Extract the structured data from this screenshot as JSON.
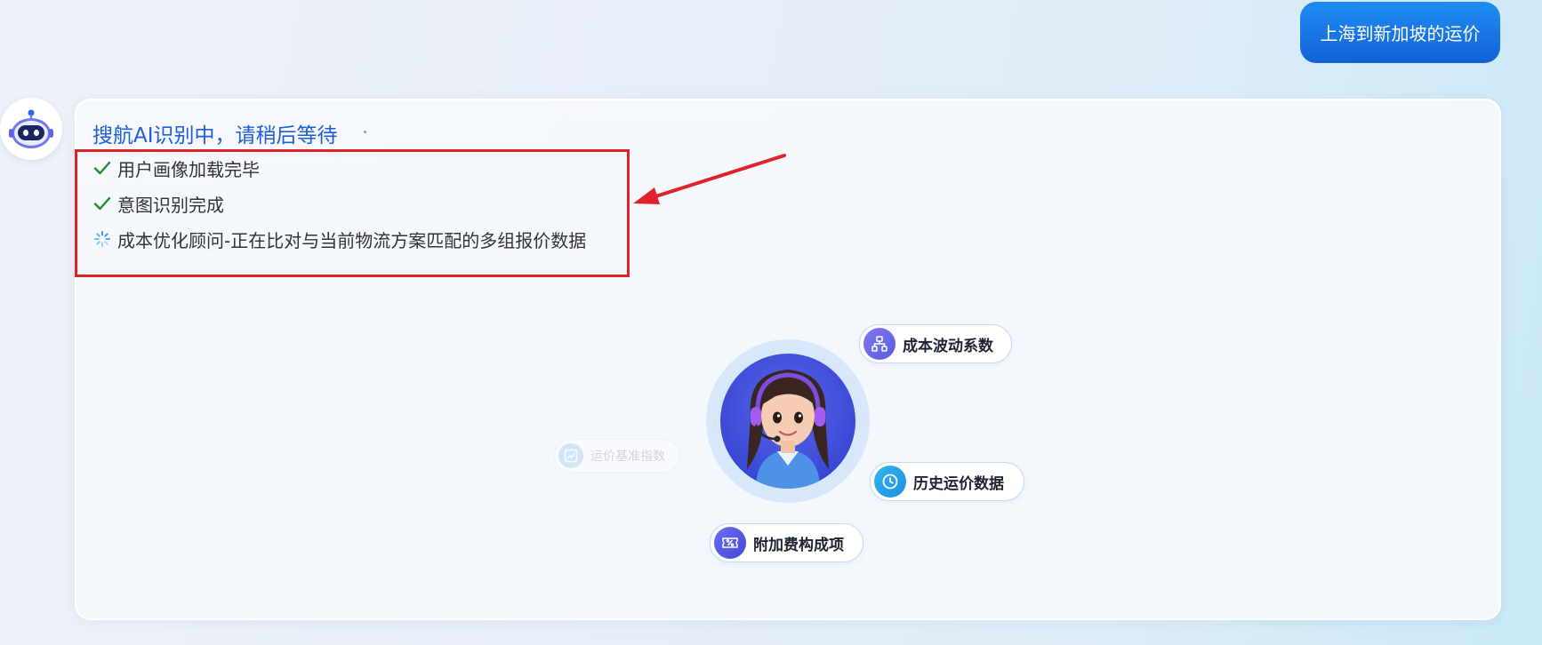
{
  "user_message": "上海到新加坡的运价",
  "assistant": {
    "status_title": "搜航AI识别中，请稍后等待",
    "steps": [
      {
        "label": "用户画像加载完毕",
        "state": "done",
        "icon": "check-icon"
      },
      {
        "label": "意图识别完成",
        "state": "done",
        "icon": "check-icon"
      },
      {
        "label": "成本优化顾问-正在比对与当前物流方案匹配的多组报价数据",
        "state": "loading",
        "icon": "spinner-icon"
      }
    ]
  },
  "agent_diagram": {
    "center": "customer-service-agent-avatar",
    "nodes": [
      {
        "label": "成本波动系数",
        "icon": "hierarchy-icon"
      },
      {
        "label": "历史运价数据",
        "icon": "clock-icon"
      },
      {
        "label": "附加费构成项",
        "icon": "percent-ticket-icon"
      },
      {
        "label": "运价基准指数",
        "icon": "trend-chart-icon"
      }
    ]
  },
  "colors": {
    "accent_blue": "#1d5fd6",
    "user_bubble": "#1677e6",
    "check_green": "#1f8a3a",
    "annotation_red": "#e1222b"
  }
}
